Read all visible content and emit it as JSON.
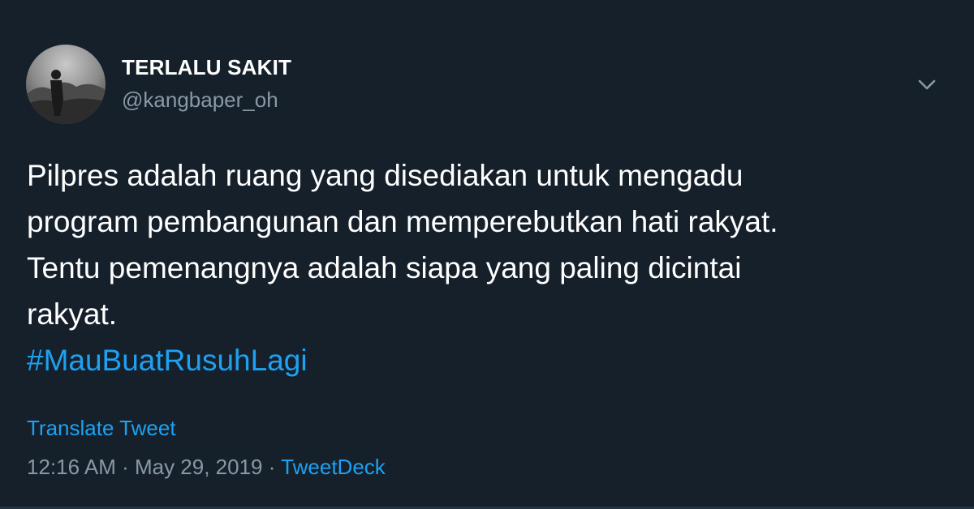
{
  "author": {
    "display_name": "TERLALU SAKIT",
    "handle": "@kangbaper_oh",
    "avatar_icon": "profile-photo"
  },
  "menu": {
    "icon": "chevron-down-icon"
  },
  "tweet": {
    "lines": [
      "Pilpres adalah ruang yang disediakan untuk mengadu",
      "program pembangunan dan memperebutkan hati rakyat.",
      "Tentu pemenangnya adalah siapa yang paling dicintai",
      "rakyat."
    ],
    "hashtag": "#MauBuatRusuhLagi"
  },
  "translate_label": "Translate Tweet",
  "meta": {
    "time": "12:16 AM",
    "separator": " · ",
    "date": "May 29, 2019",
    "source": "TweetDeck"
  },
  "colors": {
    "background": "#15202b",
    "accent": "#1da1f2",
    "secondary_text": "#8899a6"
  }
}
